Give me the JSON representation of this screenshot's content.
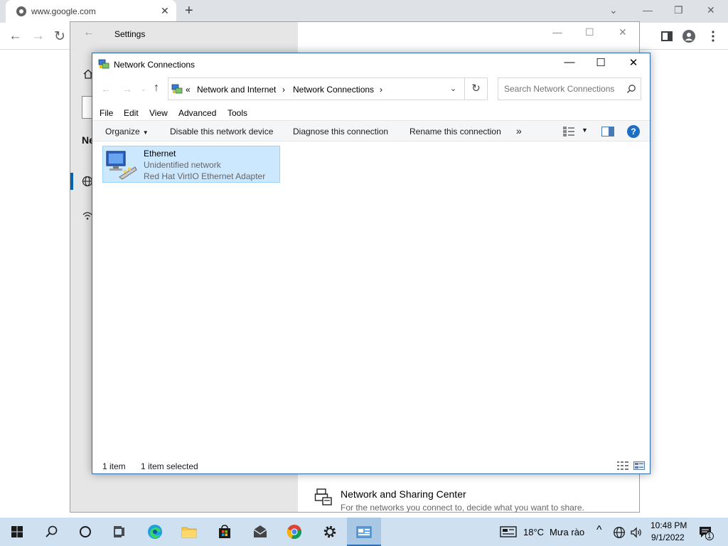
{
  "browser": {
    "tab_title": "www.google.com"
  },
  "settings": {
    "title": "Settings",
    "section_partial": "Ne",
    "nsc_title": "Network and Sharing Center",
    "nsc_desc": "For the networks you connect to, decide what you want to share."
  },
  "explorer": {
    "title": "Network Connections",
    "breadcrumb": {
      "overflow": "«",
      "level1": "Network and Internet",
      "level2": "Network Connections"
    },
    "search_placeholder": "Search Network Connections",
    "menu": [
      "File",
      "Edit",
      "View",
      "Advanced",
      "Tools"
    ],
    "commands": {
      "organize": "Organize",
      "disable": "Disable this network device",
      "diagnose": "Diagnose this connection",
      "rename": "Rename this connection",
      "more": "»"
    },
    "item": {
      "name": "Ethernet",
      "status": "Unidentified network",
      "adapter": "Red Hat VirtIO Ethernet Adapter"
    },
    "status_bar": {
      "count": "1 item",
      "selected": "1 item selected"
    }
  },
  "taskbar": {
    "weather_temp": "18°C",
    "weather_desc": "Mưa rào",
    "time": "10:48 PM",
    "date": "9/1/2022",
    "notification_count": "1"
  },
  "colors": {
    "accent": "#0063b1",
    "selection": "#cce8ff",
    "taskbar": "#cfe1f1"
  }
}
